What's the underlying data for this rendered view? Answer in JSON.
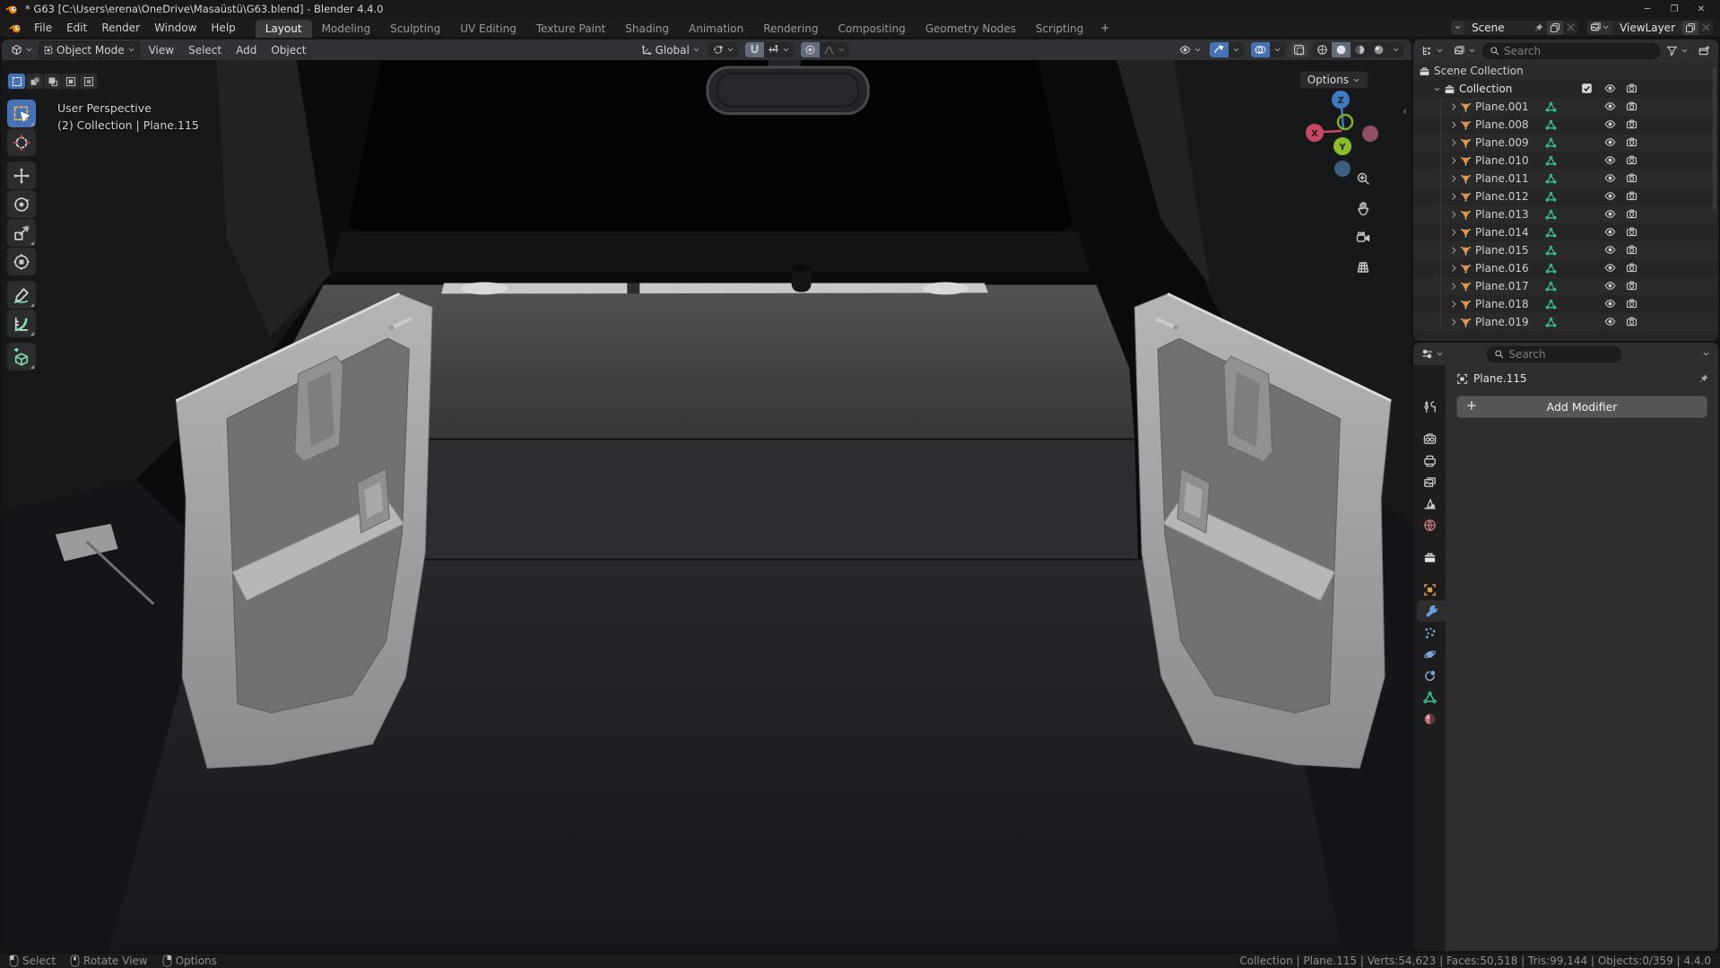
{
  "colors": {
    "accent_blue": "#4772b3",
    "object_orange": "#dd9550",
    "mesh_green": "#3fd1a0",
    "axis_x": "#c64a62",
    "axis_y": "#8fbc2f",
    "axis_z": "#3e7cc1"
  },
  "titlebar": {
    "title": "* G63 [C:\\Users\\erena\\OneDrive\\Masaüstü\\G63.blend] - Blender 4.4.0"
  },
  "menubar": {
    "menus": [
      "File",
      "Edit",
      "Render",
      "Window",
      "Help"
    ],
    "workspaces": [
      "Layout",
      "Modeling",
      "Sculpting",
      "UV Editing",
      "Texture Paint",
      "Shading",
      "Animation",
      "Rendering",
      "Compositing",
      "Geometry Nodes",
      "Scripting"
    ],
    "active_workspace": "Layout",
    "add_workspace_label": "+",
    "scene_name": "Scene",
    "view_layer_name": "ViewLayer"
  },
  "viewport_header": {
    "mode": "Object Mode",
    "menus": [
      "View",
      "Select",
      "Add",
      "Object"
    ],
    "orientation": "Global",
    "options_label": "Options"
  },
  "tool_settings": {
    "select_modes": [
      "set",
      "extend",
      "subtract",
      "invert",
      "intersect"
    ],
    "active_mode": "set"
  },
  "toolbar": {
    "groups": [
      [
        "select-box",
        "cursor"
      ],
      [
        "move",
        "rotate",
        "scale",
        "transform"
      ],
      [
        "annotate",
        "measure"
      ],
      [
        "add-cube"
      ]
    ],
    "active_tool": "select-box",
    "subtool_markers": [
      "select-box",
      "scale",
      "annotate",
      "measure",
      "add-cube"
    ]
  },
  "viewport": {
    "overlay_line1": "User Perspective",
    "overlay_line2": "(2) Collection | Plane.115",
    "axis_labels": {
      "x": "X",
      "y": "Y",
      "z": "Z"
    }
  },
  "outliner": {
    "search_placeholder": "Search",
    "scene_collection_label": "Scene Collection",
    "collection_label": "Collection",
    "items": [
      {
        "name": "Plane.001"
      },
      {
        "name": "Plane.008"
      },
      {
        "name": "Plane.009"
      },
      {
        "name": "Plane.010"
      },
      {
        "name": "Plane.011"
      },
      {
        "name": "Plane.012"
      },
      {
        "name": "Plane.013"
      },
      {
        "name": "Plane.014"
      },
      {
        "name": "Plane.015"
      },
      {
        "name": "Plane.016"
      },
      {
        "name": "Plane.017"
      },
      {
        "name": "Plane.018"
      },
      {
        "name": "Plane.019"
      }
    ]
  },
  "properties": {
    "search_placeholder": "Search",
    "breadcrumb": "Plane.115",
    "add_modifier_label": "Add Modifier",
    "tab_groups": [
      [
        "tool"
      ],
      [
        "render",
        "output",
        "view-layer",
        "scene",
        "world"
      ],
      [
        "collection"
      ],
      [
        "object",
        "modifiers",
        "particles",
        "physics",
        "constraints",
        "object-data",
        "material"
      ]
    ],
    "active_tab": "modifiers"
  },
  "statusbar": {
    "hints": [
      {
        "button": "left",
        "label": "Select"
      },
      {
        "button": "middle",
        "label": "Rotate View"
      },
      {
        "button": "right",
        "label": "Options"
      }
    ],
    "stats": "Collection | Plane.115 | Verts:54,623 | Faces:50,518 | Tris:99,144 | Objects:0/359 | 4.4.0"
  }
}
